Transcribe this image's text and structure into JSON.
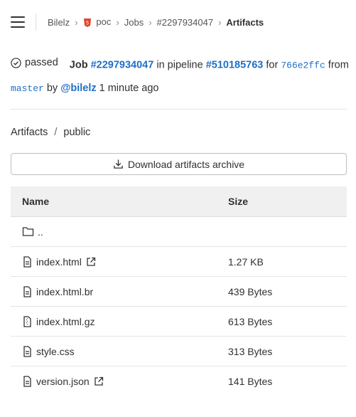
{
  "breadcrumb": {
    "items": [
      "Bilelz",
      "poc",
      "Jobs",
      "#2297934047"
    ],
    "current": "Artifacts"
  },
  "job": {
    "status": "passed",
    "job_label": "Job",
    "job_id": "#2297934047",
    "in_pipeline": "in pipeline",
    "pipeline_id": "#510185763",
    "for_text": "for",
    "commit": "766e2ffc",
    "from_text": "from",
    "branch": "master",
    "by_text": "by",
    "user": "@bilelz",
    "time": "1 minute ago"
  },
  "path": {
    "root": "Artifacts",
    "sep": "/",
    "dir": "public"
  },
  "download_label": "Download artifacts archive",
  "table": {
    "headers": {
      "name": "Name",
      "size": "Size"
    },
    "rows": [
      {
        "name": "..",
        "size": "",
        "icon": "folder-icon",
        "external": false
      },
      {
        "name": "index.html",
        "size": "1.27 KB",
        "icon": "file-icon",
        "external": true
      },
      {
        "name": "index.html.br",
        "size": "439 Bytes",
        "icon": "file-icon",
        "external": false
      },
      {
        "name": "index.html.gz",
        "size": "613 Bytes",
        "icon": "file-zip-icon",
        "external": false
      },
      {
        "name": "style.css",
        "size": "313 Bytes",
        "icon": "file-icon",
        "external": false
      },
      {
        "name": "version.json",
        "size": "141 Bytes",
        "icon": "file-icon",
        "external": true
      }
    ]
  },
  "colors": {
    "link": "#1f6fc5",
    "project_icon": "#e2432a"
  }
}
